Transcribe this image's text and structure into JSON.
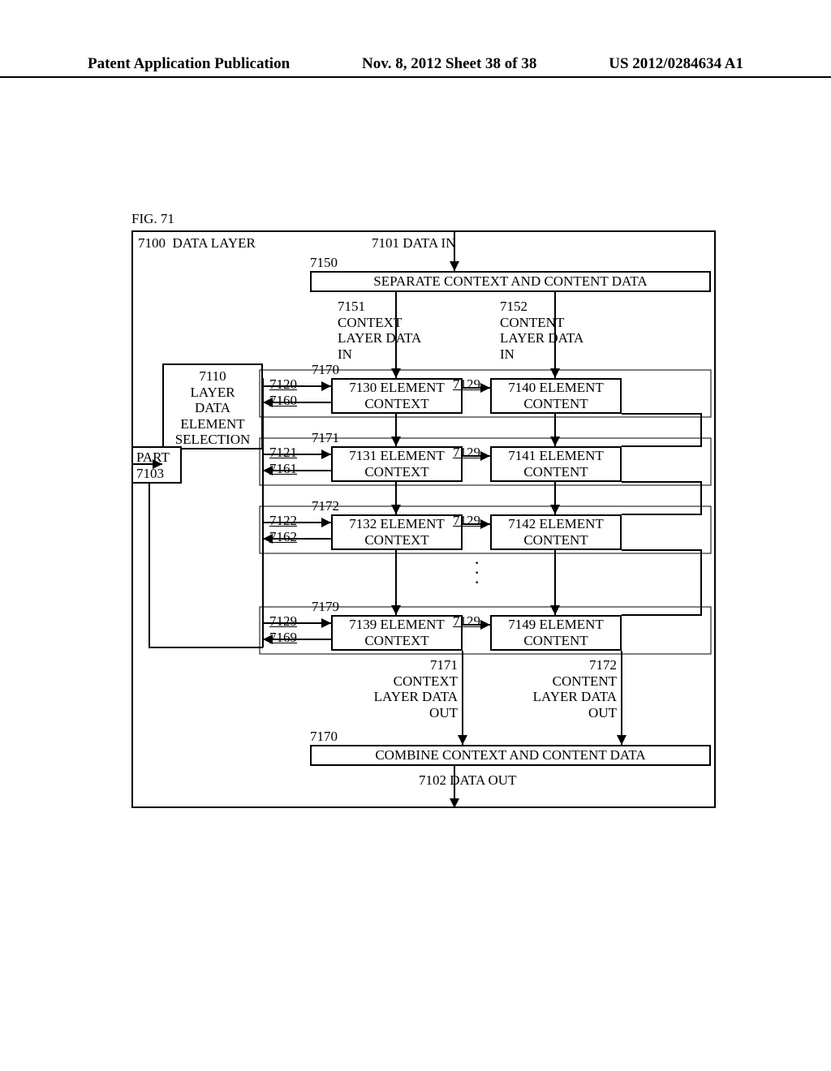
{
  "header": {
    "left": "Patent Application Publication",
    "mid": "Nov. 8, 2012   Sheet 38 of 38",
    "right": "US 2012/0284634 A1"
  },
  "figcap": "FIG. 71",
  "title": "7100  DATA LAYER",
  "data_in": "7101 DATA IN",
  "sep_num": "7150",
  "sep_box": "SEPARATE CONTEXT AND CONTENT DATA",
  "ctx_in": "7151\nCONTEXT\nLAYER DATA\nIN",
  "cnt_in": "7152\nCONTENT\nLAYER DATA\nIN",
  "sel_box": "7110\nLAYER\nDATA\nELEMENT\nSELECTION",
  "part_box": "PART\n7103",
  "rows": [
    {
      "row_top_num": "7170",
      "in": "7120",
      "out": "7160",
      "ctx": "7130 ELEMENT\nCONTEXT",
      "link": "7129",
      "cnt": "7140 ELEMENT\nCONTENT"
    },
    {
      "row_top_num": "7171",
      "in": "7121",
      "out": "7161",
      "ctx": "7131 ELEMENT\nCONTEXT",
      "link": "7129",
      "cnt": "7141 ELEMENT\nCONTENT"
    },
    {
      "row_top_num": "7172",
      "in": "7122",
      "out": "7162",
      "ctx": "7132 ELEMENT\nCONTEXT",
      "link": "7129",
      "cnt": "7142 ELEMENT\nCONTENT"
    },
    {
      "row_top_num": "7179",
      "in": "7129",
      "out": "7169",
      "ctx": "7139 ELEMENT\nCONTEXT",
      "link": "7129",
      "cnt": "7149 ELEMENT\nCONTENT"
    }
  ],
  "ctx_out": "7171\nCONTEXT\nLAYER DATA\nOUT",
  "cnt_out": "7172\nCONTENT\nLAYER DATA\nOUT",
  "comb_num": "7170",
  "comb_box": "COMBINE CONTEXT AND CONTENT DATA",
  "data_out": "7102 DATA OUT"
}
